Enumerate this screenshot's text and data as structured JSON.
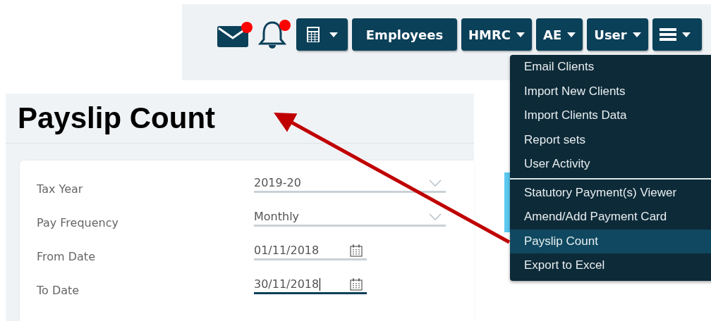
{
  "toolbar": {
    "mail": {
      "has_alert": true
    },
    "notifications": {
      "has_alert": true
    },
    "buttons": [
      {
        "kind": "calculator",
        "caret": true
      },
      {
        "kind": "text",
        "label": "Employees",
        "caret": false
      },
      {
        "kind": "text",
        "label": "HMRC",
        "caret": true
      },
      {
        "kind": "text",
        "label": "AE",
        "caret": true
      },
      {
        "kind": "text",
        "label": "User",
        "caret": true
      },
      {
        "kind": "menu",
        "caret": true
      }
    ]
  },
  "page": {
    "title": "Payslip Count",
    "fields": [
      {
        "label": "Tax Year",
        "value": "2019-20",
        "kind": "select",
        "focused": false
      },
      {
        "label": "Pay Frequency",
        "value": "Monthly",
        "kind": "select",
        "focused": false
      },
      {
        "label": "From Date",
        "value": "01/11/2018",
        "kind": "date",
        "focused": false
      },
      {
        "label": "To Date",
        "value": "30/11/2018",
        "kind": "date",
        "focused": true
      }
    ]
  },
  "menu": {
    "sections": [
      [
        {
          "label": "Email Clients",
          "selected": false
        },
        {
          "label": "Import New Clients",
          "selected": false
        },
        {
          "label": "Import Clients Data",
          "selected": false
        },
        {
          "label": "Report sets",
          "selected": false
        },
        {
          "label": "User Activity",
          "selected": false
        }
      ],
      [
        {
          "label": "Statutory Payment(s) Viewer",
          "selected": false
        },
        {
          "label": "Amend/Add Payment Card",
          "selected": false
        },
        {
          "label": "Payslip Count",
          "selected": true
        },
        {
          "label": "Export to Excel",
          "selected": false
        }
      ]
    ]
  }
}
